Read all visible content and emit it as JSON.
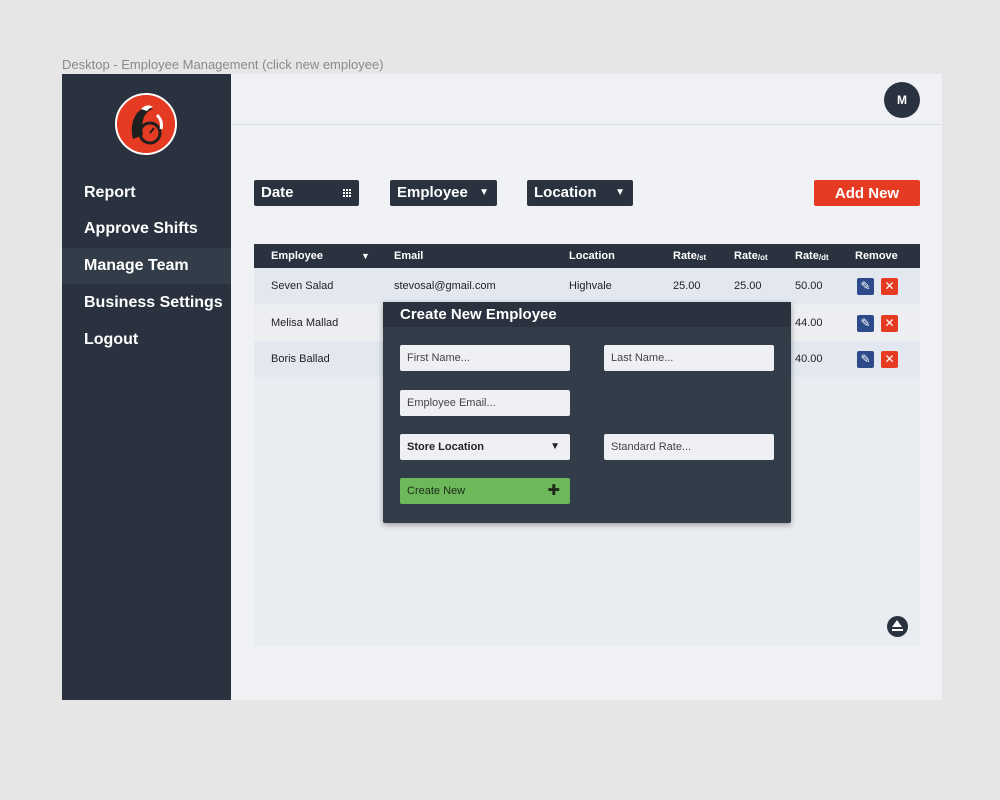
{
  "frame_title": "Desktop - Employee Management (click new employee)",
  "colors": {
    "sidebar": "#29323e",
    "accent": "#e53b22",
    "success": "#6cb85a",
    "edit": "#2d4a8a"
  },
  "sidebar": {
    "items": [
      {
        "label": "Report"
      },
      {
        "label": "Approve Shifts"
      },
      {
        "label": "Manage Team",
        "active": true
      },
      {
        "label": "Business Settings"
      },
      {
        "label": "Logout"
      }
    ]
  },
  "user": {
    "initial": "M"
  },
  "filters": {
    "date": "Date",
    "employee": "Employee",
    "location": "Location"
  },
  "add_new_label": "Add New",
  "table": {
    "headers": {
      "employee": "Employee",
      "email": "Email",
      "location": "Location",
      "rate_st": "Rate",
      "rate_st_sub": "/st",
      "rate_ot": "Rate",
      "rate_ot_sub": "/ot",
      "rate_dt": "Rate",
      "rate_dt_sub": "/dt",
      "remove": "Remove"
    },
    "rows": [
      {
        "name": "Seven Salad",
        "email": "stevosal@gmail.com",
        "location": "Highvale",
        "rate_st": "25.00",
        "rate_ot": "25.00",
        "rate_dt": "50.00"
      },
      {
        "name": "Melisa Mallad",
        "rate_dt": "44.00"
      },
      {
        "name": "Boris Ballad",
        "rate_dt": "40.00"
      }
    ]
  },
  "modal": {
    "title": "Create New Employee",
    "first_name_placeholder": "First Name...",
    "last_name_placeholder": "Last Name...",
    "email_placeholder": "Employee Email...",
    "store_location_label": "Store Location",
    "standard_rate_placeholder": "Standard Rate...",
    "create_label": "Create New"
  },
  "icons": {
    "edit": "pencil-icon",
    "remove": "close-icon",
    "filter_caret": "caret-down-icon",
    "date": "grid-icon",
    "scroll_top": "eject-icon",
    "create": "plus-icon"
  }
}
